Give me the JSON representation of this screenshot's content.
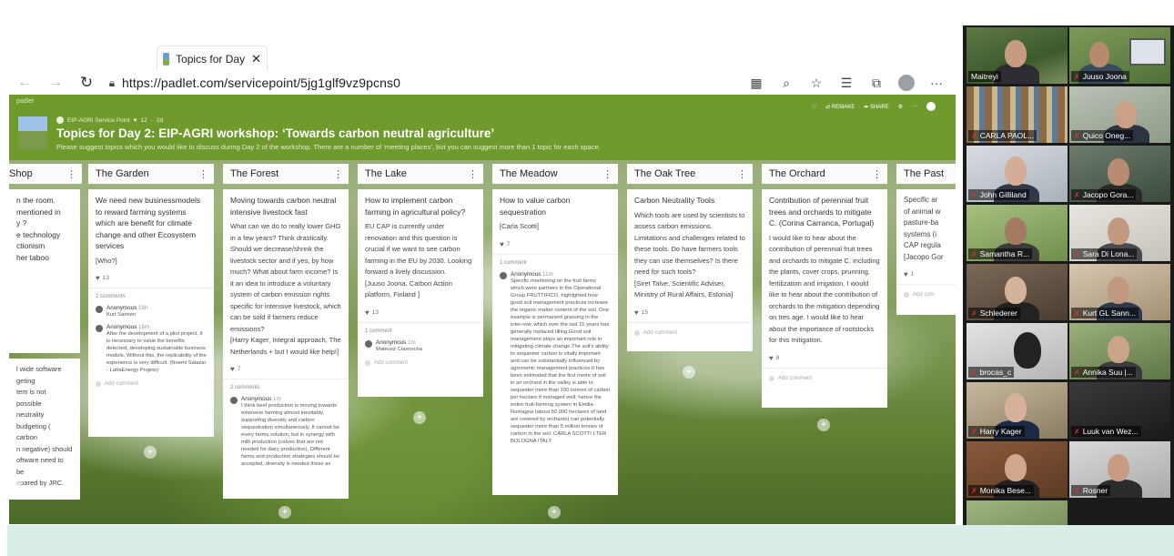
{
  "browser": {
    "tab_title": "Topics for Day",
    "tab_close": "✕",
    "url": "https://padlet.com/servicepoint/5jg1glf9vz9pcns0",
    "icons": [
      "reader-view-icon",
      "zoom-icon",
      "favorites-star-icon",
      "favorites-bar-icon",
      "collections-icon",
      "profile-icon",
      "more-icon"
    ]
  },
  "padlet": {
    "logo": "padlet",
    "author": "EIP-AGRI Service Point",
    "likes": "12",
    "age": "2d",
    "title": "Topics for Day 2: EIP-AGRI workshop: ‘Towards carbon neutral agriculture’",
    "subtitle": "Please suggest topics which you would like to discuss during Day 2 of the workshop. There are a number of ‘meeting places’, but you can suggest more than 1 topic for each space.",
    "actions": {
      "remake": "REMAKE",
      "share": "SHARE"
    },
    "columns": [
      {
        "title": "Shop",
        "cards": [
          {
            "subject": "",
            "body": "n the room.\nmentioned in\ny ?\ne technology\nctionism\nher taboo"
          },
          {
            "subject": "",
            "body": "l wide software\ngeting\ntem is not possible\nneutrality\nbudgeting ( carbon\nn negative) should\noftware need to be\nepared by JRC."
          }
        ]
      },
      {
        "title": "The Garden",
        "cards": [
          {
            "subject": "We need new businessmodels to reward farming systems which are benefit for climate change and other Ecosystem services",
            "body": "[Who?]",
            "likes": "13",
            "comments_count": "2 comments",
            "comments": [
              {
                "name": "Anonymous",
                "time": "16h",
                "text": "Kurt Sannen"
              },
              {
                "name": "Anonymous",
                "time": "16m",
                "text": "After the development of a pilot project, it is necessary to value the benefits detected, developing sustainable business models. Without this, the replicability of the experience is very difficult. (Noemi Salazar - LatraEnergy Projeto)"
              }
            ],
            "add": "Add comment"
          }
        ]
      },
      {
        "title": "The Forest",
        "cards": [
          {
            "subject": "Moving towards carbon neutral intensive livestock fast",
            "body": "What can we do to really lower GHG in a few years? Think drastically. Should we decrease/shrink the livestock sector and if yes, by how much? What about farm income? Is it an idea to introduce a voluntary system of carbon emission rights specific for intensive livestock, which can be sold if farmers reduce emissions?\n[Harry Kager, Integral approach, The Netherlands + but I would like help!]",
            "likes": "7",
            "comments_count": "2 comments",
            "comments": [
              {
                "name": "Anonymous",
                "time": "1m",
                "text": "I think beef production is moving towards extensive farming almost inevitably, supporting diversity and carbon sequestration simultaneously. It cannot be every farms solution, but in synergy with milk production (calves that are not needed for dairy production). Different farms and production strategies should be accepted, diversity is needed these as"
              }
            ]
          }
        ]
      },
      {
        "title": "The Lake",
        "cards": [
          {
            "subject": "How to implement carbon farming in agricultural policy?",
            "body": "EU CAP is currently under renovation and this question is crucial if we want to see carbon farming in the EU by 2030. Looking forward a lively discussion.\n[Juuso Joona, Carbon Action platform, Finland ]",
            "likes": "13",
            "comments_count": "1 comment",
            "comments": [
              {
                "name": "Anonymous",
                "time": "1m",
                "text": "Mateusz Ciasnocha"
              }
            ],
            "add": "Add comment"
          }
        ]
      },
      {
        "title": "The Meadow",
        "cards": [
          {
            "subject": "How to value carbon sequestration",
            "body": "[Carla Scotti]",
            "likes": "7",
            "comments_count": "1 comment",
            "comments": [
              {
                "name": "Anonymous",
                "time": "11m",
                "text": "Specific monitoring on the fruit farms which were partners in the Operational Group FRUTTIFICO, highlighted how good soil management practices increase the organic matter content of the soil. One example is permanent grassing in the inter-row, which over the last 15 years has generally replaced tilling.Good soil management plays an important role in mitigating climate change.The soil's ability to sequester carbon is vitally important and can be substantially influenced by agronomic management practices.It has been estimated that the first metre of soil in an orchard in the valley is able to sequester more than 100 tonnes of carbon per hectare if managed well; hence the entire fruit-farming system in Emilia-Romagna (about 50,000 hectares of land are covered by orchards) can potentially sequester more than 5 million tonnes of carbon in the soil. CARLA SCOTTI I.TER BOLOGNA ITALY"
              }
            ]
          }
        ]
      },
      {
        "title": "The Oak Tree",
        "cards": [
          {
            "subject": "Carbon Neutrality Tools",
            "body": "Which tools are used by scientists to assess carbon emissions. Limitations and challenges related to these tools.  Do have farmers tools they can use themselves? Is there need for such tools?\n[Siret Talve, Scientific Adviser, Ministry of Rural Affairs, Estonia]",
            "likes": "15",
            "add": "Add comment"
          }
        ]
      },
      {
        "title": "The Orchard",
        "cards": [
          {
            "subject": "Contribution of perennial fruit trees and orchards to mitigate C. (Corina Carranca, Portugal)",
            "body": "I would like to hear about the contribution of perennial fruit trees and orchards to mitigate C, including the plants, cover crops, prunning, fertilization and irrigation. I would like to hear about the contribution of orchards to the mitigation depending on tres age. I would like to hear about the importance of rootstocks for this mitigation.",
            "likes": "8",
            "add": "Add comment"
          }
        ]
      },
      {
        "title": "The Past",
        "cards": [
          {
            "subject": "",
            "body": "Specific ar\nof animal w\npasture-ba\nsystems (i\nCAP regula\n[Jacopo Gor",
            "likes": "1",
            "add": "Add com"
          }
        ]
      }
    ]
  },
  "participants": [
    {
      "name": "Maitreyi",
      "muted": false
    },
    {
      "name": "Juuso Joona",
      "muted": true
    },
    {
      "name": "CARLA PAOL...",
      "muted": true
    },
    {
      "name": "Quico Oneg...",
      "muted": true
    },
    {
      "name": "John Gilliland",
      "muted": true
    },
    {
      "name": "Jacopo Gora...",
      "muted": true
    },
    {
      "name": "Samantha R...",
      "muted": true
    },
    {
      "name": "Sara Di Lona...",
      "muted": true
    },
    {
      "name": "Schlederer",
      "muted": true
    },
    {
      "name": "Kurt GL Sann...",
      "muted": true
    },
    {
      "name": "brocas_c",
      "muted": true
    },
    {
      "name": "Annika Suu |...",
      "muted": true
    },
    {
      "name": "Harry Kager",
      "muted": true
    },
    {
      "name": "Luuk van Wez...",
      "muted": true
    },
    {
      "name": "Monika Bese...",
      "muted": true
    },
    {
      "name": "Rosner",
      "muted": true
    }
  ],
  "colors": {
    "padlet_header": "#6f9a2c",
    "bottom_band": "#d9eee6",
    "muted_mic": "#e5312f"
  }
}
